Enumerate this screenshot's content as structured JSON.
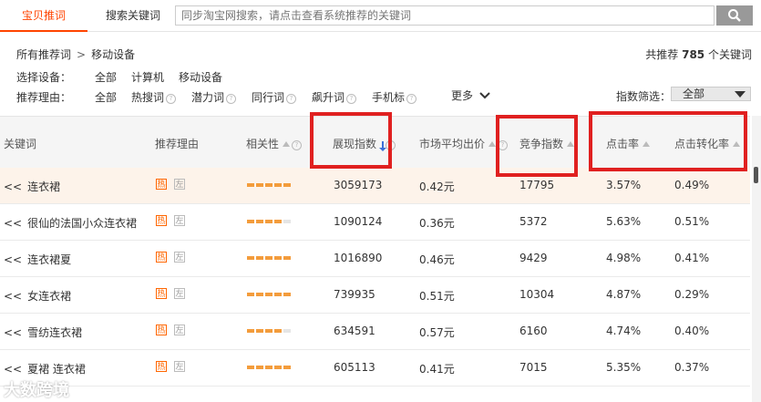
{
  "tabs": {
    "active": "宝贝推词",
    "second": "搜索关键词"
  },
  "search": {
    "placeholder": "同步淘宝网搜索，请点击查看系统推荐的关键词",
    "button_icon": "search-icon"
  },
  "breadcrumb": {
    "root": "所有推荐词",
    "sep": ">",
    "current": "移动设备"
  },
  "total": {
    "prefix": "共推荐",
    "count": "785",
    "suffix": "个关键词"
  },
  "device": {
    "label": "选择设备：",
    "options": [
      "全部",
      "计算机",
      "移动设备"
    ]
  },
  "reason": {
    "label": "推荐理由：",
    "options": [
      "全部",
      "热搜词",
      "潜力词",
      "同行词",
      "飙升词",
      "手机标"
    ],
    "more": "更多"
  },
  "index_filter": {
    "label": "指数筛选：",
    "value": "全部"
  },
  "columns": [
    "关键词",
    "推荐理由",
    "相关性",
    "展现指数",
    "市场平均出价",
    "竞争指数",
    "点击率",
    "点击转化率"
  ],
  "row_prefix": "<<",
  "badges": {
    "hot": "热",
    "sub": "左"
  },
  "rows": [
    {
      "keyword": "连衣裙",
      "relevance": 5,
      "impressions": "3059173",
      "avg_bid": "0.42元",
      "competition": "17795",
      "ctr": "3.57%",
      "cvr": "0.49%"
    },
    {
      "keyword": "很仙的法国小众连衣裙",
      "relevance": 4,
      "impressions": "1090124",
      "avg_bid": "0.36元",
      "competition": "5372",
      "ctr": "5.63%",
      "cvr": "0.51%"
    },
    {
      "keyword": "连衣裙夏",
      "relevance": 5,
      "impressions": "1016890",
      "avg_bid": "0.46元",
      "competition": "9429",
      "ctr": "4.98%",
      "cvr": "0.41%"
    },
    {
      "keyword": "女连衣裙",
      "relevance": 5,
      "impressions": "739935",
      "avg_bid": "0.51元",
      "competition": "10304",
      "ctr": "4.87%",
      "cvr": "0.29%"
    },
    {
      "keyword": "雪纺连衣裙",
      "relevance": 4,
      "impressions": "634591",
      "avg_bid": "0.57元",
      "competition": "6160",
      "ctr": "4.74%",
      "cvr": "0.40%"
    },
    {
      "keyword": "夏裙 连衣裙",
      "relevance": 5,
      "impressions": "605113",
      "avg_bid": "0.41元",
      "competition": "7015",
      "ctr": "5.35%",
      "cvr": "0.37%"
    }
  ],
  "watermark": "大数跨境"
}
